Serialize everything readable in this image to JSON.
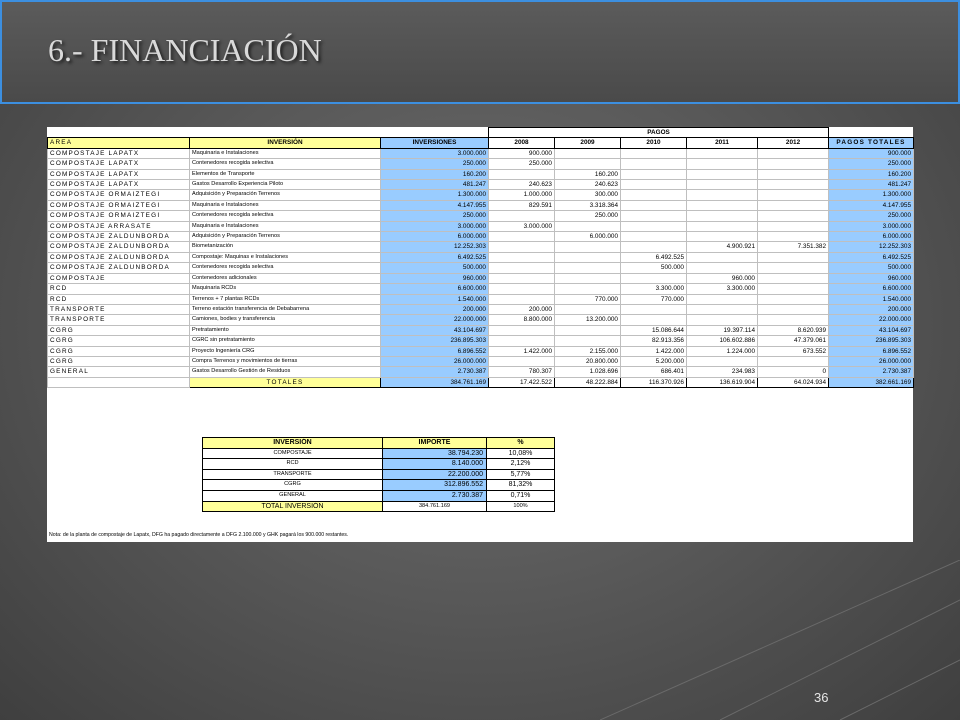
{
  "slide": {
    "title": "6.- FINANCIACIÓN",
    "page_number": "36"
  },
  "table": {
    "pagos_label": "PAGOS",
    "headers": [
      "AREA",
      "INVERSIÓN",
      "INVERSIONES",
      "2008",
      "2009",
      "2010",
      "2011",
      "2012",
      "PAGOS TOTALES"
    ],
    "rows": [
      [
        "COMPOSTAJE LAPATX",
        "Maquinaria e Instalaciones",
        "3.000.000",
        "900.000",
        "",
        "",
        "",
        "",
        "900.000"
      ],
      [
        "COMPOSTAJE LAPATX",
        "Contenedores recogida selectiva",
        "250.000",
        "250.000",
        "",
        "",
        "",
        "",
        "250.000"
      ],
      [
        "COMPOSTAJE LAPATX",
        "Elementos de Transporte",
        "160.200",
        "",
        "160.200",
        "",
        "",
        "",
        "160.200"
      ],
      [
        "COMPOSTAJE LAPATX",
        "Gastos Desarrollo Experiencia Piloto",
        "481.247",
        "240.623",
        "240.623",
        "",
        "",
        "",
        "481.247"
      ],
      [
        "COMPOSTAJE ORMAIZTEGI",
        "Adquisición y Preparación Terrenos",
        "1.300.000",
        "1.000.000",
        "300.000",
        "",
        "",
        "",
        "1.300.000"
      ],
      [
        "COMPOSTAJE ORMAIZTEGI",
        "Maquinaria e Instalaciones",
        "4.147.955",
        "829.591",
        "3.318.364",
        "",
        "",
        "",
        "4.147.955"
      ],
      [
        "COMPOSTAJE ORMAIZTEGI",
        "Contenedores recogida selectiva",
        "250.000",
        "",
        "250.000",
        "",
        "",
        "",
        "250.000"
      ],
      [
        "COMPOSTAJE ARRASATE",
        "Maquinaria e Instalaciones",
        "3.000.000",
        "3.000.000",
        "",
        "",
        "",
        "",
        "3.000.000"
      ],
      [
        "COMPOSTAJE ZALDUNBORDA",
        "Adquisición y Preparación Terrenos",
        "6.000.000",
        "",
        "6.000.000",
        "",
        "",
        "",
        "6.000.000"
      ],
      [
        "COMPOSTAJE ZALDUNBORDA",
        "Biometanización",
        "12.252.303",
        "",
        "",
        "",
        "4.900.921",
        "7.351.382",
        "12.252.303"
      ],
      [
        "COMPOSTAJE ZALDUNBORDA",
        "Compostaje: Maquinas e Instalaciones",
        "6.492.525",
        "",
        "",
        "6.492.525",
        "",
        "",
        "6.492.525"
      ],
      [
        "COMPOSTAJE ZALDUNBORDA",
        "Contenedores recogida selectiva",
        "500.000",
        "",
        "",
        "500.000",
        "",
        "",
        "500.000"
      ],
      [
        "COMPOSTAJE",
        "Contenedores adicionales",
        "960.000",
        "",
        "",
        "",
        "960.000",
        "",
        "960.000"
      ],
      [
        "RCD",
        "Maquinaria RCDs",
        "6.600.000",
        "",
        "",
        "3.300.000",
        "3.300.000",
        "",
        "6.600.000"
      ],
      [
        "RCD",
        "Terrenos + 7 plantas RCDs",
        "1.540.000",
        "",
        "770.000",
        "770.000",
        "",
        "",
        "1.540.000"
      ],
      [
        "TRANSPORTE",
        "Terreno estación transferencia de Debabarrena",
        "200.000",
        "200.000",
        "",
        "",
        "",
        "",
        "200.000"
      ],
      [
        "TRANSPORTE",
        "Camiones, bodies y transferencia",
        "22.000.000",
        "8.800.000",
        "13.200.000",
        "",
        "",
        "",
        "22.000.000"
      ],
      [
        "CGRG",
        "Pretratamiento",
        "43.104.697",
        "",
        "",
        "15.086.644",
        "19.397.114",
        "8.620.939",
        "43.104.697"
      ],
      [
        "CGRG",
        "CGRC sin pretratamiento",
        "236.895.303",
        "",
        "",
        "82.913.356",
        "106.602.886",
        "47.379.061",
        "236.895.303"
      ],
      [
        "CGRG",
        "Proyecto Ingeniería CRG",
        "6.896.552",
        "1.422.000",
        "2.155.000",
        "1.422.000",
        "1.224.000",
        "673.552",
        "6.896.552"
      ],
      [
        "CGRG",
        "Compra Terrenos y movimientos de tierras",
        "26.000.000",
        "",
        "20.800.000",
        "5.200.000",
        "",
        "",
        "26.000.000"
      ],
      [
        "GENERAL",
        "Gastos Desarrollo Gestión de Residuos",
        "2.730.387",
        "780.307",
        "1.028.696",
        "686.401",
        "234.983",
        "0",
        "2.730.387"
      ]
    ],
    "totals": [
      "TOTALES",
      "384.761.169",
      "17.422.522",
      "48.222.884",
      "116.370.926",
      "136.619.904",
      "64.024.934",
      "382.661.169"
    ]
  },
  "summary": {
    "headers": [
      "INVERSIÓN",
      "IMPORTE",
      "%"
    ],
    "rows": [
      [
        "COMPOSTAJE",
        "38.794.230",
        "10,08%"
      ],
      [
        "RCD",
        "8.140.000",
        "2,12%"
      ],
      [
        "TRANSPORTE",
        "22.200.000",
        "5,77%"
      ],
      [
        "CGRG",
        "312.896.552",
        "81,32%"
      ],
      [
        "GENERAL",
        "2.730.387",
        "0,71%"
      ]
    ],
    "total": [
      "TOTAL INVERSIÓN",
      "384.761.169",
      "100%"
    ]
  },
  "note": "Nota: de la planta de compostaje de Lapatx, DFG ha pagado directamente a DFG 2.100.000 y GHK pagará los 900.000 restantes."
}
